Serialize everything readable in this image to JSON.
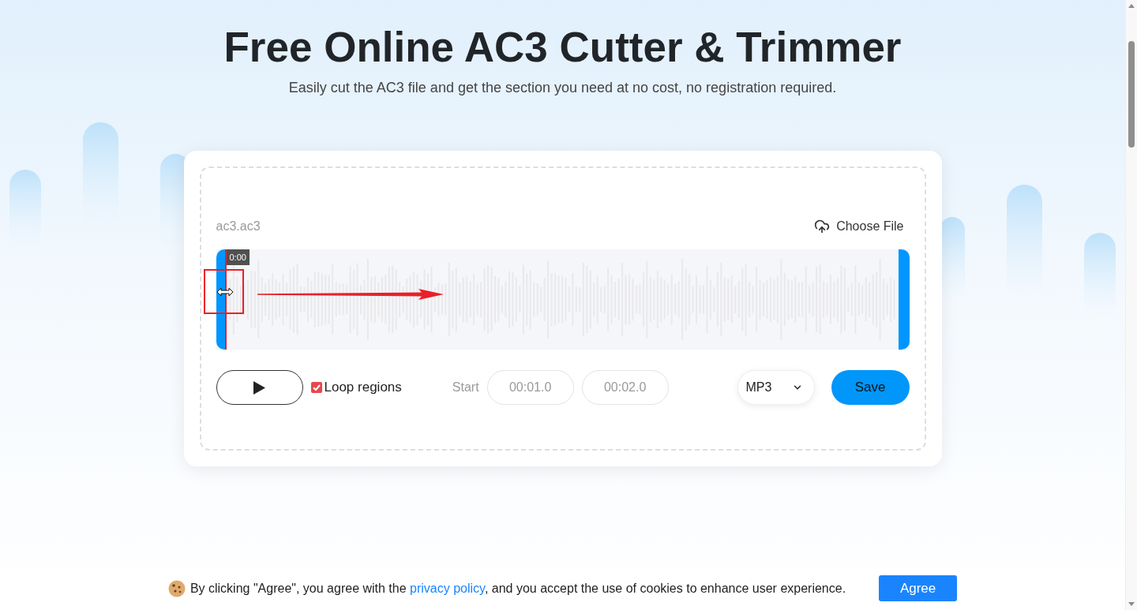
{
  "header": {
    "title": "Free Online AC3 Cutter & Trimmer",
    "subtitle": "Easily cut the AC3 file and get the section you need at no cost, no registration required."
  },
  "editor": {
    "file_name": "ac3.ac3",
    "choose_file": "Choose File",
    "playhead_time": "0:00",
    "loop_regions": {
      "label": "Loop regions",
      "checked": true
    },
    "start_label": "Start",
    "time_fields": [
      {
        "placeholder": "00:01.0"
      },
      {
        "placeholder": "00:02.0"
      }
    ],
    "format": {
      "value": "MP3"
    },
    "save": "Save"
  },
  "cookie_banner": {
    "notice_start": "By clicking \"Agree\", you agree with the ",
    "link": "privacy policy",
    "notice_end": ", and you accept the use of cookies to enhance user experience.",
    "button": "Agree"
  }
}
